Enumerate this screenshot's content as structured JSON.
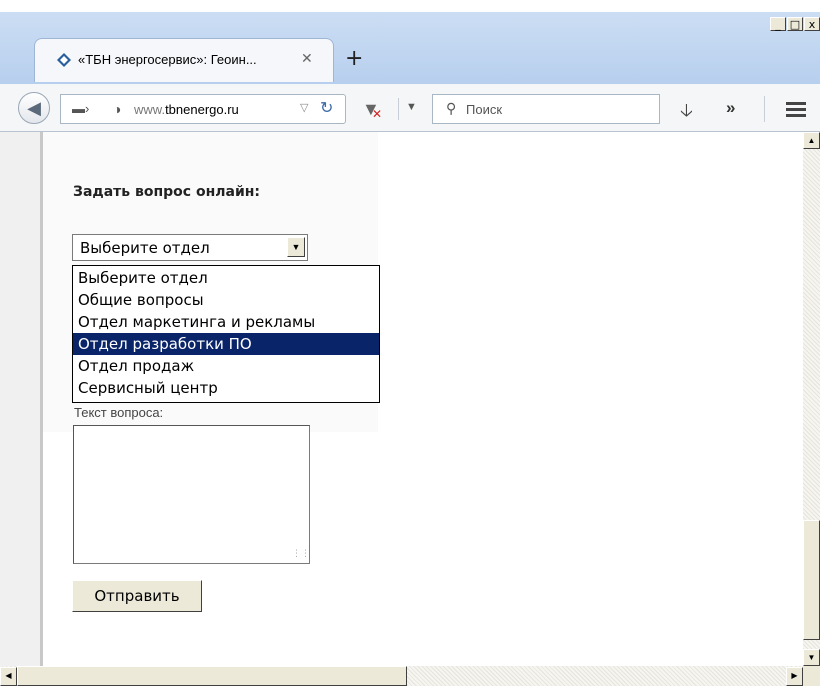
{
  "browser": {
    "tab_title": "«ТБН энергосервис»: Геоин...",
    "tab_close": "✕",
    "new_tab": "+",
    "url_domain": "www.",
    "url_host": "tbnenergo.ru",
    "search_placeholder": "Поиск",
    "window_buttons": {
      "minimize": "_",
      "maximize": "□",
      "close": "x"
    }
  },
  "form": {
    "title": "Задать вопрос онлайн:",
    "select_value": "Выберите отдел",
    "options": [
      {
        "label": "Выберите отдел",
        "selected": false
      },
      {
        "label": "Общие вопросы",
        "selected": false
      },
      {
        "label": "Отдел маркетинга и рекламы",
        "selected": false
      },
      {
        "label": "Отдел разработки ПО",
        "selected": true
      },
      {
        "label": "Отдел продаж",
        "selected": false
      },
      {
        "label": "Сервисный центр",
        "selected": false
      }
    ],
    "question_label": "Текст вопроса:",
    "question_value": "",
    "submit_label": "Отправить"
  },
  "colors": {
    "highlight": "#0a246a",
    "titlebar": "#b7cfee"
  },
  "icons": [
    "back-arrow-icon",
    "identity-icon",
    "globe-icon",
    "reload-icon",
    "addon-icon",
    "search-icon",
    "download-icon",
    "overflow-icon",
    "hamburger-menu-icon",
    "dropdown-arrow-icon"
  ]
}
